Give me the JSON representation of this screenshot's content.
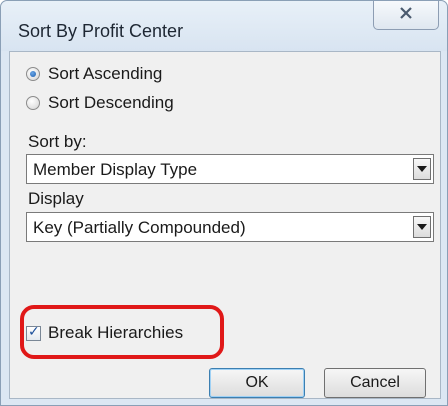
{
  "window": {
    "title": "Sort By Profit Center",
    "close_icon": "close-icon"
  },
  "sort_order": {
    "options": [
      {
        "label": "Sort Ascending",
        "selected": true
      },
      {
        "label": "Sort Descending",
        "selected": false
      }
    ]
  },
  "sort_by": {
    "label": "Sort by:",
    "value": "Member Display Type"
  },
  "display": {
    "label": "Display",
    "value": "Key (Partially Compounded)"
  },
  "break_hierarchies": {
    "label": "Break Hierarchies",
    "checked": true
  },
  "buttons": {
    "ok": "OK",
    "cancel": "Cancel"
  },
  "colors": {
    "annotation": "#e01818",
    "accent": "#1d5fb0"
  }
}
